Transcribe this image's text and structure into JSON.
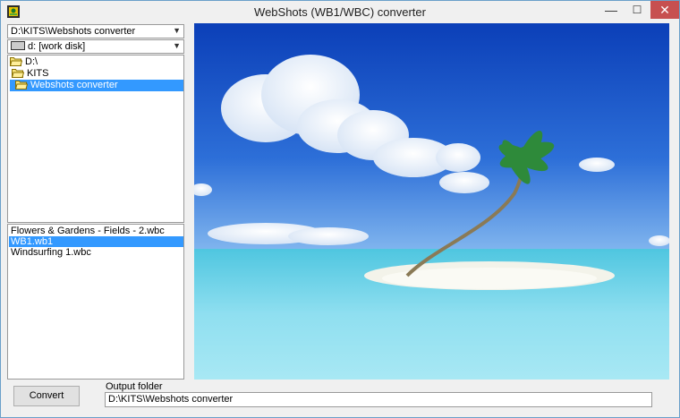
{
  "window": {
    "title": "WebShots (WB1/WBC) converter",
    "controls": {
      "minimize": "—",
      "maximize": "☐",
      "close": "✕"
    }
  },
  "path_combo": {
    "value": "D:\\KITS\\Webshots converter"
  },
  "drive_combo": {
    "value": "d: [work disk]",
    "icon": "drive-icon"
  },
  "folder_tree": {
    "items": [
      {
        "label": "D:\\",
        "icon": "open-folder-icon",
        "level": 0,
        "selected": false
      },
      {
        "label": "KITS",
        "icon": "open-folder-icon",
        "level": 1,
        "selected": false
      },
      {
        "label": "Webshots converter",
        "icon": "open-folder-icon",
        "level": 2,
        "selected": true
      }
    ]
  },
  "file_list": {
    "items": [
      {
        "label": "Flowers & Gardens - Fields - 2.wbc",
        "selected": false
      },
      {
        "label": "WB1.wb1",
        "selected": true
      },
      {
        "label": "Windsurfing 1.wbc",
        "selected": false
      }
    ]
  },
  "preview": {
    "description_icon": "tropical-island-image"
  },
  "bottom": {
    "convert_label": "Convert",
    "output_folder_label": "Output folder",
    "output_folder_value": "D:\\KITS\\Webshots converter"
  },
  "colors": {
    "selection": "#3399ff",
    "close_button": "#c75050",
    "window_border": "#6a9fc9"
  }
}
